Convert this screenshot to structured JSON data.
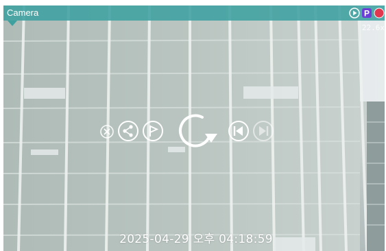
{
  "window": {
    "title": "Camera"
  },
  "overlay": {
    "zoom": "22.6x",
    "timestamp": "2025-04-29 오후 04:18:59"
  },
  "icons": {
    "play_circle": "play-circle-icon",
    "p_badge": "P",
    "record": "record-icon",
    "close": "close-icon",
    "share": "share-icon",
    "flag": "flag-icon",
    "refresh": "refresh-icon",
    "prev": "previous-icon",
    "next": "next-icon"
  },
  "colors": {
    "titlebar": "#3fa0a0",
    "p_badge": "#6b3fd6",
    "record": "#e0384e"
  }
}
